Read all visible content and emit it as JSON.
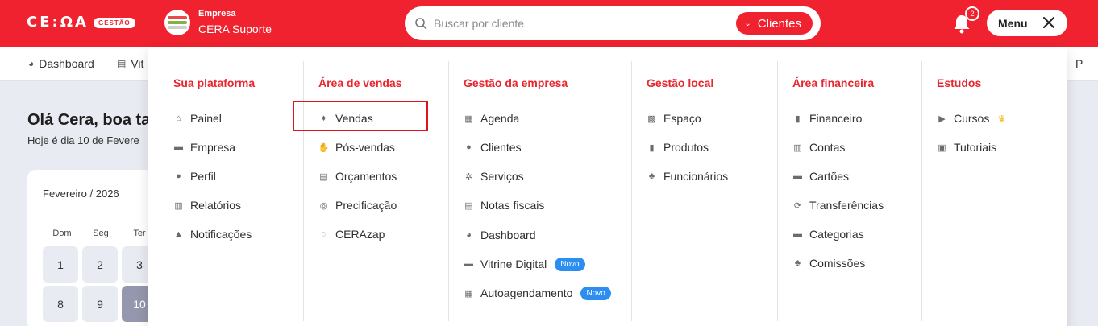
{
  "app": {
    "logo": "CE:ΩA",
    "logo_badge": "GESTÃO"
  },
  "company": {
    "label": "Empresa",
    "name": "CERA Suporte"
  },
  "search": {
    "placeholder": "Buscar por cliente",
    "filter_label": "Clientes"
  },
  "notifications": {
    "count": "2"
  },
  "menu_button": {
    "label": "Menu"
  },
  "subnav": {
    "items": [
      {
        "label": "Dashboard"
      },
      {
        "label": "Vit"
      }
    ],
    "right_item": "P"
  },
  "page": {
    "greeting": "Olá Cera, boa ta",
    "date_line": "Hoje é dia 10 de Fevere"
  },
  "calendar": {
    "month": "Fevereiro / 2026",
    "weekdays": [
      "Dom",
      "Seg",
      "Ter"
    ],
    "days": [
      "1",
      "2",
      "3",
      "8",
      "9",
      "10"
    ],
    "active_day": "10"
  },
  "mega_menu": {
    "columns": [
      {
        "title": "Sua plataforma",
        "items": [
          {
            "label": "Painel",
            "icon": "home-icon"
          },
          {
            "label": "Empresa",
            "icon": "briefcase-icon"
          },
          {
            "label": "Perfil",
            "icon": "user-icon"
          },
          {
            "label": "Relatórios",
            "icon": "report-icon"
          },
          {
            "label": "Notificações",
            "icon": "bell-icon"
          }
        ]
      },
      {
        "title": "Área de vendas",
        "items": [
          {
            "label": "Vendas",
            "icon": "money-bag-icon"
          },
          {
            "label": "Pós-vendas",
            "icon": "hand-icon"
          },
          {
            "label": "Orçamentos",
            "icon": "document-icon"
          },
          {
            "label": "Precificação",
            "icon": "coin-icon"
          },
          {
            "label": "CERAzap",
            "icon": "whatsapp-icon"
          }
        ]
      },
      {
        "title": "Gestão da empresa",
        "items": [
          {
            "label": "Agenda",
            "icon": "calendar-icon"
          },
          {
            "label": "Clientes",
            "icon": "users-icon"
          },
          {
            "label": "Serviços",
            "icon": "gear-icon"
          },
          {
            "label": "Notas fiscais",
            "icon": "invoice-icon"
          },
          {
            "label": "Dashboard",
            "icon": "pie-chart-icon"
          },
          {
            "label": "Vitrine Digital",
            "icon": "store-icon",
            "badge": "Novo"
          },
          {
            "label": "Autoagendamento",
            "icon": "calendar-grid-icon",
            "badge": "Novo"
          }
        ]
      },
      {
        "title": "Gestão local",
        "items": [
          {
            "label": "Espaço",
            "icon": "space-icon"
          },
          {
            "label": "Produtos",
            "icon": "products-icon"
          },
          {
            "label": "Funcionários",
            "icon": "team-icon"
          }
        ]
      },
      {
        "title": "Área financeira",
        "items": [
          {
            "label": "Financeiro",
            "icon": "bar-chart-icon"
          },
          {
            "label": "Contas",
            "icon": "bank-icon"
          },
          {
            "label": "Cartões",
            "icon": "card-icon"
          },
          {
            "label": "Transferências",
            "icon": "transfer-icon"
          },
          {
            "label": "Categorias",
            "icon": "folder-icon"
          },
          {
            "label": "Comissões",
            "icon": "team-icon"
          }
        ]
      },
      {
        "title": "Estudos",
        "items": [
          {
            "label": "Cursos",
            "icon": "play-icon",
            "crown": true
          },
          {
            "label": "Tutoriais",
            "icon": "video-icon"
          }
        ]
      }
    ]
  },
  "colors": {
    "brand": "#f0222f",
    "title": "#e8262f",
    "badge": "#2b8ef0",
    "highlight": "#e0141e"
  }
}
